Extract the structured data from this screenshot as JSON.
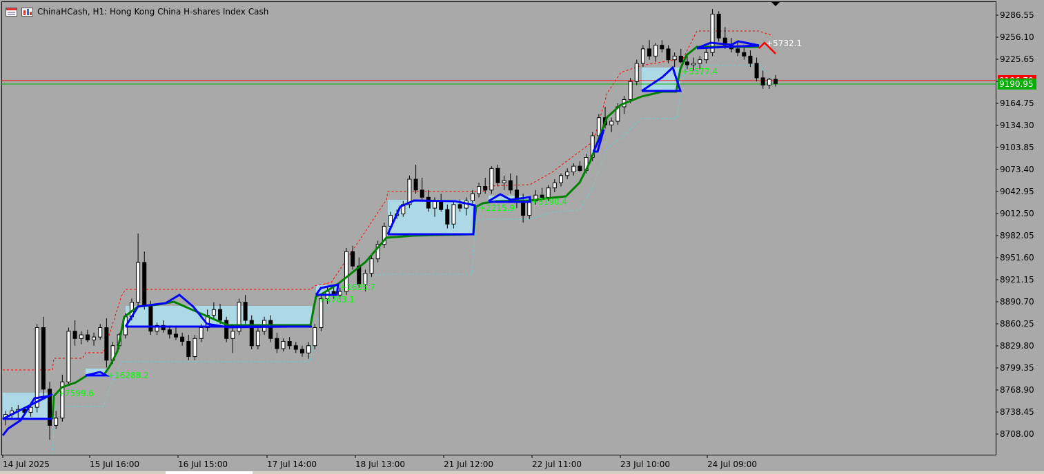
{
  "window": {
    "symbol_title": "ChinaHCash, H1:  Hong Kong China H-shares Index Cash"
  },
  "icons": [
    "chart-window-icon",
    "symbol-bars-icon"
  ],
  "colors": {
    "background": "#a9a9a9",
    "axis": "#000000",
    "bull_candle": "#ffffff",
    "bear_candle": "#000000",
    "blue_line": "#0000ff",
    "green_line": "#008000",
    "red_dotted": "#ff0000",
    "cyan_dotted": "#5fd7d7",
    "box_fill": "#add8e6",
    "bid_line": "#ff0000",
    "ask_line": "#00b000",
    "label_green": "#00ff00",
    "label_white": "#ffffff"
  },
  "price_axis": {
    "ticks": [
      "9286.55",
      "9256.10",
      "9225.65",
      "9195.20",
      "9164.75",
      "9134.30",
      "9103.85",
      "9073.40",
      "9042.95",
      "9012.50",
      "8982.05",
      "8951.60",
      "8921.15",
      "8890.70",
      "8860.25",
      "8829.80",
      "8799.35",
      "8768.90",
      "8738.45",
      "8708.00"
    ],
    "current_bid": "9196.70",
    "current_ask": "9190.95"
  },
  "time_axis": {
    "labels": [
      "14 Jul 2025",
      "15 Jul 16:00",
      "16 Jul 15:00",
      "17 Jul 14:00",
      "18 Jul 13:00",
      "21 Jul 12:00",
      "22 Jul 11:00",
      "23 Jul 10:00",
      "24 Jul 09:00"
    ]
  },
  "chart_data": {
    "type": "candlestick",
    "title": "ChinaHCash, H1:  Hong Kong China H-shares Index Cash",
    "ylim": [
      8680,
      9305
    ],
    "candles": [
      [
        8730,
        8740,
        8720,
        8735
      ],
      [
        8735,
        8745,
        8728,
        8740
      ],
      [
        8740,
        8748,
        8730,
        8742
      ],
      [
        8742,
        8745,
        8735,
        8738
      ],
      [
        8738,
        8750,
        8732,
        8745
      ],
      [
        8745,
        8860,
        8738,
        8855
      ],
      [
        8855,
        8870,
        8760,
        8770
      ],
      [
        8770,
        8780,
        8700,
        8720
      ],
      [
        8720,
        8740,
        8715,
        8730
      ],
      [
        8730,
        8790,
        8725,
        8780
      ],
      [
        8780,
        8855,
        8775,
        8850
      ],
      [
        8850,
        8865,
        8830,
        8840
      ],
      [
        8840,
        8850,
        8832,
        8845
      ],
      [
        8845,
        8852,
        8835,
        8838
      ],
      [
        8838,
        8848,
        8830,
        8842
      ],
      [
        8842,
        8860,
        8838,
        8855
      ],
      [
        8855,
        8868,
        8800,
        8810
      ],
      [
        8810,
        8835,
        8805,
        8830
      ],
      [
        8830,
        8848,
        8825,
        8845
      ],
      [
        8845,
        8875,
        8840,
        8870
      ],
      [
        8870,
        8895,
        8865,
        8890
      ],
      [
        8890,
        8985,
        8885,
        8945
      ],
      [
        8945,
        8960,
        8880,
        8885
      ],
      [
        8885,
        8892,
        8845,
        8850
      ],
      [
        8850,
        8862,
        8845,
        8858
      ],
      [
        8858,
        8865,
        8848,
        8852
      ],
      [
        8852,
        8858,
        8840,
        8846
      ],
      [
        8846,
        8855,
        8838,
        8842
      ],
      [
        8842,
        8848,
        8830,
        8836
      ],
      [
        8836,
        8845,
        8810,
        8815
      ],
      [
        8815,
        8845,
        8810,
        8840
      ],
      [
        8840,
        8860,
        8835,
        8855
      ],
      [
        8855,
        8880,
        8850,
        8872
      ],
      [
        8872,
        8890,
        8865,
        8880
      ],
      [
        8880,
        8888,
        8860,
        8865
      ],
      [
        8865,
        8870,
        8835,
        8840
      ],
      [
        8840,
        8860,
        8820,
        8850
      ],
      [
        8850,
        8895,
        8845,
        8890
      ],
      [
        8890,
        8900,
        8860,
        8865
      ],
      [
        8865,
        8872,
        8825,
        8830
      ],
      [
        8830,
        8855,
        8825,
        8850
      ],
      [
        8850,
        8870,
        8845,
        8865
      ],
      [
        8865,
        8872,
        8835,
        8840
      ],
      [
        8840,
        8848,
        8820,
        8826
      ],
      [
        8826,
        8840,
        8822,
        8836
      ],
      [
        8836,
        8842,
        8825,
        8830
      ],
      [
        8830,
        8835,
        8820,
        8825
      ],
      [
        8825,
        8830,
        8815,
        8820
      ],
      [
        8820,
        8835,
        8812,
        8830
      ],
      [
        8830,
        8860,
        8825,
        8855
      ],
      [
        8855,
        8900,
        8850,
        8895
      ],
      [
        8895,
        8910,
        8888,
        8905
      ],
      [
        8905,
        8912,
        8895,
        8900
      ],
      [
        8900,
        8910,
        8895,
        8905
      ],
      [
        8905,
        8965,
        8900,
        8960
      ],
      [
        8960,
        8968,
        8935,
        8940
      ],
      [
        8940,
        8952,
        8910,
        8915
      ],
      [
        8915,
        8935,
        8905,
        8930
      ],
      [
        8930,
        8955,
        8925,
        8950
      ],
      [
        8950,
        8975,
        8945,
        8970
      ],
      [
        8970,
        9000,
        8965,
        8995
      ],
      [
        8995,
        9015,
        8990,
        9010
      ],
      [
        9010,
        9018,
        9005,
        9012
      ],
      [
        9012,
        9030,
        9008,
        9025
      ],
      [
        9025,
        9065,
        9020,
        9060
      ],
      [
        9060,
        9080,
        9040,
        9045
      ],
      [
        9045,
        9062,
        9030,
        9035
      ],
      [
        9035,
        9045,
        9015,
        9020
      ],
      [
        9020,
        9035,
        9008,
        9030
      ],
      [
        9030,
        9040,
        9015,
        9018
      ],
      [
        9018,
        9025,
        8992,
        8998
      ],
      [
        8998,
        9030,
        8992,
        9025
      ],
      [
        9025,
        9032,
        9015,
        9020
      ],
      [
        9020,
        9035,
        9010,
        9030
      ],
      [
        9030,
        9045,
        9025,
        9040
      ],
      [
        9040,
        9055,
        9035,
        9050
      ],
      [
        9050,
        9062,
        9040,
        9045
      ],
      [
        9045,
        9078,
        9040,
        9075
      ],
      [
        9075,
        9080,
        9050,
        9055
      ],
      [
        9055,
        9065,
        9045,
        9058
      ],
      [
        9058,
        9068,
        9040,
        9045
      ],
      [
        9045,
        9065,
        9020,
        9030
      ],
      [
        9030,
        9040,
        9000,
        9010
      ],
      [
        9010,
        9035,
        9005,
        9030
      ],
      [
        9030,
        9045,
        9025,
        9038
      ],
      [
        9038,
        9048,
        9030,
        9035
      ],
      [
        9035,
        9052,
        9030,
        9048
      ],
      [
        9048,
        9060,
        9042,
        9055
      ],
      [
        9055,
        9068,
        9050,
        9065
      ],
      [
        9065,
        9075,
        9060,
        9070
      ],
      [
        9070,
        9082,
        9065,
        9078
      ],
      [
        9078,
        9085,
        9070,
        9072
      ],
      [
        9072,
        9095,
        9068,
        9090
      ],
      [
        9090,
        9125,
        9085,
        9120
      ],
      [
        9120,
        9150,
        9115,
        9145
      ],
      [
        9145,
        9160,
        9130,
        9135
      ],
      [
        9135,
        9145,
        9125,
        9140
      ],
      [
        9140,
        9165,
        9135,
        9160
      ],
      [
        9160,
        9175,
        9150,
        9170
      ],
      [
        9170,
        9200,
        9165,
        9195
      ],
      [
        9195,
        9225,
        9190,
        9220
      ],
      [
        9220,
        9245,
        9215,
        9240
      ],
      [
        9240,
        9252,
        9225,
        9230
      ],
      [
        9230,
        9248,
        9222,
        9245
      ],
      [
        9245,
        9252,
        9235,
        9240
      ],
      [
        9240,
        9245,
        9220,
        9225
      ],
      [
        9225,
        9235,
        9215,
        9230
      ],
      [
        9230,
        9240,
        9220,
        9222
      ],
      [
        9222,
        9230,
        9212,
        9218
      ],
      [
        9218,
        9228,
        9210,
        9220
      ],
      [
        9220,
        9230,
        9212,
        9225
      ],
      [
        9225,
        9240,
        9220,
        9235
      ],
      [
        9235,
        9295,
        9230,
        9288
      ],
      [
        9288,
        9292,
        9250,
        9255
      ],
      [
        9255,
        9270,
        9240,
        9245
      ],
      [
        9245,
        9255,
        9235,
        9240
      ],
      [
        9240,
        9250,
        9230,
        9235
      ],
      [
        9235,
        9245,
        9225,
        9230
      ],
      [
        9230,
        9238,
        9215,
        9220
      ],
      [
        9220,
        9228,
        9195,
        9200
      ],
      [
        9200,
        9210,
        9185,
        9190
      ],
      [
        9190,
        9200,
        9185,
        9198
      ],
      [
        9198,
        9204,
        9188,
        9192
      ]
    ],
    "signal_labels": [
      "+7599.6",
      "+16288.2",
      "+1635.7",
      "+4703.1",
      "+2215.9",
      "+3190.4",
      "+5577.4",
      "+5732.1"
    ]
  }
}
